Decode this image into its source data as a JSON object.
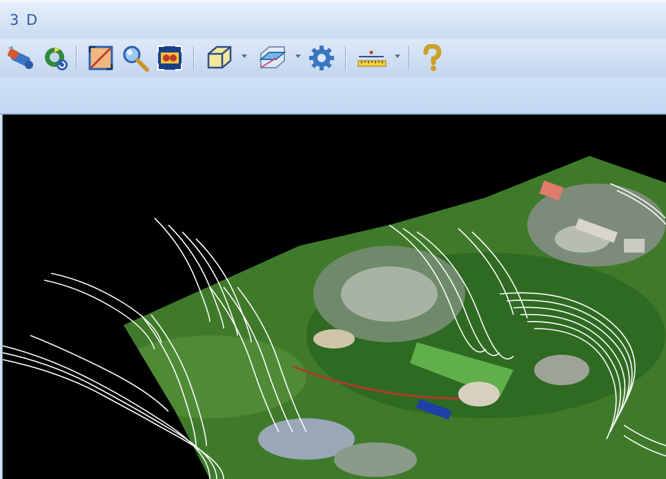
{
  "window": {
    "title": "3 D"
  },
  "toolbar": {
    "icons": [
      "fly-icon",
      "refresh-icon",
      "fit-view-icon",
      "zoom-icon",
      "full-extent-icon",
      "box-view-icon",
      "slice-view-icon",
      "settings-gear-icon",
      "measure-ruler-icon",
      "help-icon"
    ]
  },
  "viewport": {
    "content": "3d-terrain-scene"
  },
  "colors": {
    "title_text": "#2f5a9a",
    "toolbar_bg": "#cfe0f5",
    "viewport_bg": "#000000",
    "vegetation": "#3f7a2a",
    "contour": "#ffffff"
  }
}
